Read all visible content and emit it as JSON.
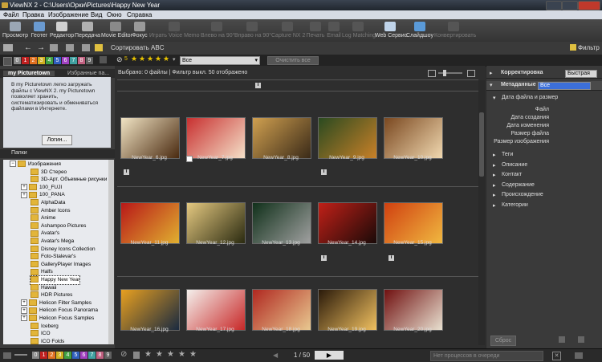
{
  "window": {
    "title": "ViewNX 2 - C:\\Users\\Орки\\Pictures\\Happy New Year"
  },
  "menu": [
    "Файл",
    "Правка",
    "Изображение",
    "Вид",
    "Окно",
    "Справка"
  ],
  "toolbar": [
    {
      "label": "Просмотр",
      "icon": "viewer-icon",
      "enabled": true
    },
    {
      "label": "Геотег",
      "icon": "geotag-icon",
      "enabled": true
    },
    {
      "label": "Редактор",
      "icon": "editor-icon",
      "enabled": true
    },
    {
      "label": "Передача",
      "icon": "transfer-icon",
      "enabled": true
    },
    {
      "label": "Movie Editor",
      "icon": "movie-editor-icon",
      "enabled": true
    },
    {
      "label": "Фокус",
      "icon": "focus-icon",
      "enabled": true
    },
    {
      "label": "Играть Voice Memo",
      "icon": "voice-memo-icon",
      "enabled": false
    },
    {
      "label": "Влево на 90°",
      "icon": "rotate-left-icon",
      "enabled": false
    },
    {
      "label": "Вправо на 90°",
      "icon": "rotate-right-icon",
      "enabled": false
    },
    {
      "label": "Capture NX 2",
      "icon": "capture-nx2-icon",
      "enabled": false
    },
    {
      "label": "Печать",
      "icon": "print-icon",
      "enabled": false
    },
    {
      "label": "Email",
      "icon": "email-icon",
      "enabled": false
    },
    {
      "label": "Log Matching",
      "icon": "log-matching-icon",
      "enabled": false
    },
    {
      "label": "Web Сервис",
      "icon": "web-service-icon",
      "enabled": true
    },
    {
      "label": "Слайдшоу",
      "icon": "slideshow-icon",
      "enabled": true
    },
    {
      "label": "Конвертировать",
      "icon": "convert-icon",
      "enabled": false
    }
  ],
  "sort": {
    "label": "Сортировать ABC"
  },
  "filter": {
    "label": "Фильтр"
  },
  "labelbar": {
    "labels": [
      "0",
      "1",
      "2",
      "3",
      "4",
      "5",
      "6",
      "7",
      "8",
      "9"
    ],
    "rating_number": "5",
    "dropdown_value": "Все",
    "clear_button": "Очистить все"
  },
  "leftpane": {
    "tabs": [
      "my Picturetown",
      "Избранные па..."
    ],
    "picturetown_text": "В my Picturetown легко загружать файлы с ViewNX 2. my Picturetown позволяет хранить, систематизировать и обмениваться файлами в Интернете.",
    "login_button": "Логин...",
    "folders_title": "Папки",
    "tree": [
      {
        "name": "Изображения",
        "level": 0,
        "expander": "−"
      },
      {
        "name": "3D Стерео",
        "level": 1,
        "expander": ""
      },
      {
        "name": "3D-Арт. Объемные рисунки",
        "level": 1,
        "expander": ""
      },
      {
        "name": "100_FUJI",
        "level": 1,
        "expander": "+"
      },
      {
        "name": "100_PANA",
        "level": 1,
        "expander": "+"
      },
      {
        "name": "AlphaData",
        "level": 1,
        "expander": ""
      },
      {
        "name": "Amber Icons",
        "level": 1,
        "expander": ""
      },
      {
        "name": "Anime",
        "level": 1,
        "expander": ""
      },
      {
        "name": "Ashampoo Pictures",
        "level": 1,
        "expander": ""
      },
      {
        "name": "Avatar's",
        "level": 1,
        "expander": ""
      },
      {
        "name": "Avatar's Mega",
        "level": 1,
        "expander": ""
      },
      {
        "name": "Disney Icons Collection",
        "level": 1,
        "expander": ""
      },
      {
        "name": "Foto-Stalevar's",
        "level": 1,
        "expander": ""
      },
      {
        "name": "GalleryPlayer Images",
        "level": 1,
        "expander": ""
      },
      {
        "name": "Halfs",
        "level": 1,
        "expander": ""
      },
      {
        "name": "Happy New Year",
        "level": 1,
        "expander": "",
        "selected": true
      },
      {
        "name": "Hawaii",
        "level": 1,
        "expander": ""
      },
      {
        "name": "HDR Pictures",
        "level": 1,
        "expander": ""
      },
      {
        "name": "Helicon Filter Samples",
        "level": 1,
        "expander": "+"
      },
      {
        "name": "Helicon Focus Panorama",
        "level": 1,
        "expander": "+"
      },
      {
        "name": "Helicon Focus Samples",
        "level": 1,
        "expander": "+"
      },
      {
        "name": "Iceberg",
        "level": 1,
        "expander": ""
      },
      {
        "name": "ICO",
        "level": 1,
        "expander": ""
      },
      {
        "name": "ICO Folds",
        "level": 1,
        "expander": ""
      }
    ]
  },
  "center": {
    "status": "Выбрано: 0 файлы | Фильтр выкл.  50 отображено",
    "thumbnails": [
      {
        "name": "NewYear_6.jpg",
        "colors": [
          "#f1e4c4",
          "#4a2a10"
        ]
      },
      {
        "name": "NewYear_7.jpg",
        "colors": [
          "#c83030",
          "#f4e0c8"
        ]
      },
      {
        "name": "NewYear_8.jpg",
        "colors": [
          "#d0a050",
          "#3a2a18"
        ]
      },
      {
        "name": "NewYear_9.jpg",
        "colors": [
          "#2a4a20",
          "#c88028"
        ]
      },
      {
        "name": "NewYear_10.jpg",
        "colors": [
          "#7a4820",
          "#f0d8b0"
        ]
      },
      {
        "name": "NewYear_11.jpg",
        "colors": [
          "#b81818",
          "#e0b030"
        ]
      },
      {
        "name": "NewYear_12.jpg",
        "colors": [
          "#e4c880",
          "#2a2a10"
        ]
      },
      {
        "name": "NewYear_13.jpg",
        "colors": [
          "#10301a",
          "#a0a0a0"
        ]
      },
      {
        "name": "NewYear_14.jpg",
        "colors": [
          "#c02018",
          "#1a0a08"
        ]
      },
      {
        "name": "NewYear_15.jpg",
        "colors": [
          "#d04010",
          "#f0b840"
        ]
      },
      {
        "name": "NewYear_16.jpg",
        "colors": [
          "#e8a020",
          "#1a2a40"
        ]
      },
      {
        "name": "NewYear_17.jpg",
        "colors": [
          "#f4f0ec",
          "#c82828"
        ]
      },
      {
        "name": "NewYear_18.jpg",
        "colors": [
          "#b02820",
          "#e8c890"
        ]
      },
      {
        "name": "NewYear_19.jpg",
        "colors": [
          "#2a1a0a",
          "#f0c060"
        ]
      },
      {
        "name": "NewYear_20.jpg",
        "colors": [
          "#701010",
          "#e8e0d0"
        ]
      }
    ]
  },
  "rightpane": {
    "adjust_title": "Корректировка",
    "adjust_value": "Быстрая",
    "metadata_title": "Метаданные",
    "metadata_value": "Все",
    "section": "Дата файла и размер",
    "fields": [
      "Файл",
      "Дата создания",
      "Дата изменения",
      "Размер файла",
      "Размер изображения"
    ],
    "categories": [
      "Теги",
      "Описание",
      "Контакт",
      "Содержание",
      "Происхождение",
      "Категории"
    ],
    "reset_button": "Сброс"
  },
  "bottom": {
    "page": "1 / 50",
    "status": "Нет процессов в очереди"
  },
  "colors": {
    "label_colors": [
      "#888888",
      "#c02020",
      "#e07020",
      "#d0b020",
      "#40a040",
      "#3060c0",
      "#a040c0",
      "#40a0a0",
      "#c06080",
      "#606060"
    ]
  }
}
